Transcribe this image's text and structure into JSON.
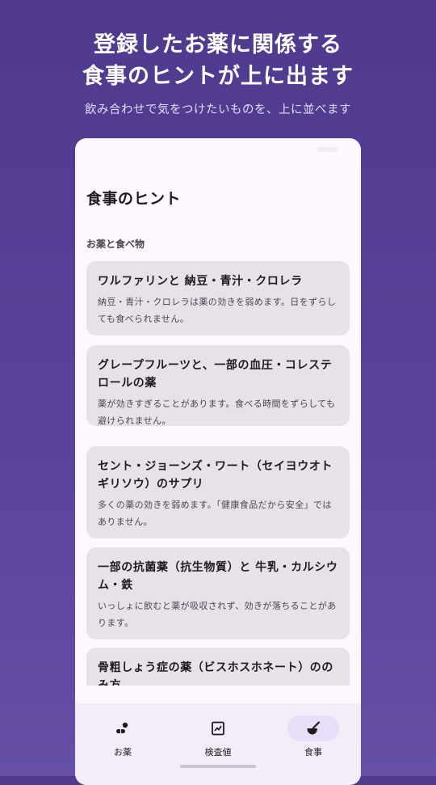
{
  "promo": {
    "title_line1": "登録したお薬に関係する",
    "title_line2": "食事のヒントが上に出ます",
    "subtitle": "飲み合わせで気をつけたいものを、上に並べます"
  },
  "screen": {
    "title": "食事のヒント",
    "section_label": "お薬と食べ物"
  },
  "hints": [
    {
      "title": "ワルファリンと 納豆・青汁・クロレラ",
      "description": "納豆・青汁・クロレラは薬の効きを弱めます。日をずらしても食べられません。"
    },
    {
      "title": "グレープフルーツと、一部の血圧・コレステロールの薬",
      "description": "薬が効きすぎることがあります。食べる時間をずらしても避けられません。"
    },
    {
      "title": "セント・ジョーンズ・ワート（セイヨウオトギリソウ）のサプリ",
      "description": "多くの薬の効きを弱めます。「健康食品だから安全」ではありません。"
    },
    {
      "title": "一部の抗菌薬（抗生物質）と 牛乳・カルシウム・鉄",
      "description": "いっしょに飲むと薬が吸収されず、効きが落ちることがあります。"
    },
    {
      "title": "骨粗しょう症の薬（ビスホスホネート）ののみ方",
      "description": ""
    }
  ],
  "nav": {
    "items": [
      {
        "label": "お薬",
        "icon": "pill-icon",
        "active": false
      },
      {
        "label": "検査値",
        "icon": "chart-icon",
        "active": false
      },
      {
        "label": "食事",
        "icon": "food-icon",
        "active": true
      }
    ]
  },
  "colors": {
    "background": "#5a429a",
    "card": "#e8e1ea",
    "active_indicator": "#e8def8"
  }
}
